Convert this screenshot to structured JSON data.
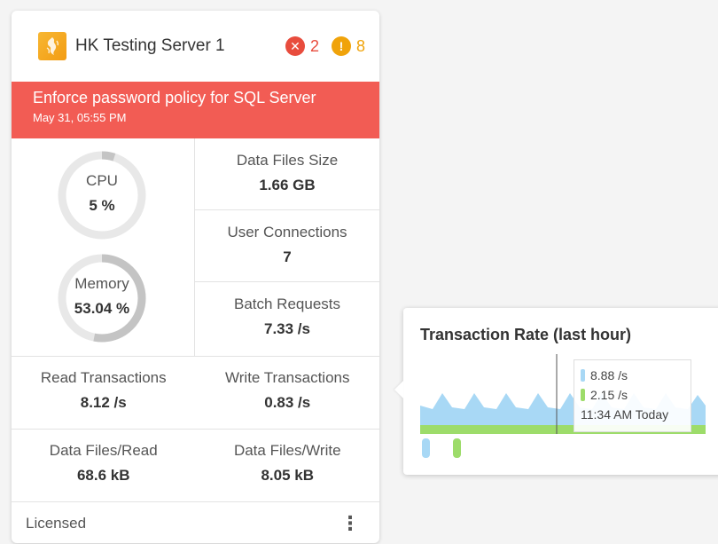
{
  "server": {
    "name": "HK Testing Server 1",
    "icon": "server-brand-icon",
    "errors": "2",
    "warnings": "8",
    "error_icon": "x-circle-icon",
    "warning_icon": "exclamation-circle-icon"
  },
  "alert": {
    "title": "Enforce password policy for SQL Server",
    "time": "May 31, 05:55 PM"
  },
  "gauges": {
    "cpu": {
      "label": "CPU",
      "value": "5 %",
      "fraction": 0.05
    },
    "memory": {
      "label": "Memory",
      "value": "53.04 %",
      "fraction": 0.5304
    }
  },
  "stats": [
    {
      "label": "Data Files Size",
      "value": "1.66 GB"
    },
    {
      "label": "User Connections",
      "value": "7"
    },
    {
      "label": "Batch Requests",
      "value": "7.33 /s"
    }
  ],
  "transactions": {
    "read_label": "Read Transactions",
    "read_value": "8.12 /s",
    "write_label": "Write Transactions",
    "write_value": "0.83 /s"
  },
  "data_files": {
    "read_label": "Data Files/Read",
    "read_value": "68.6 kB",
    "write_label": "Data Files/Write",
    "write_value": "8.05 kB"
  },
  "footer": {
    "label": "Licensed",
    "menu_icon": "kebab-menu-icon"
  },
  "popup": {
    "title": "Transaction Rate (last hour)",
    "tooltip": {
      "series1_value": "8.88 /s",
      "series2_value": "2.15 /s",
      "time": "11:34 AM Today"
    }
  },
  "colors": {
    "alert": "#f25c54",
    "error": "#e84c3d",
    "warning": "#f0a30a",
    "series1": "#a8d8f5",
    "series2": "#9ddc6a",
    "gauge_track": "#e8e8e8",
    "gauge_fill": "#c4c4c4"
  }
}
